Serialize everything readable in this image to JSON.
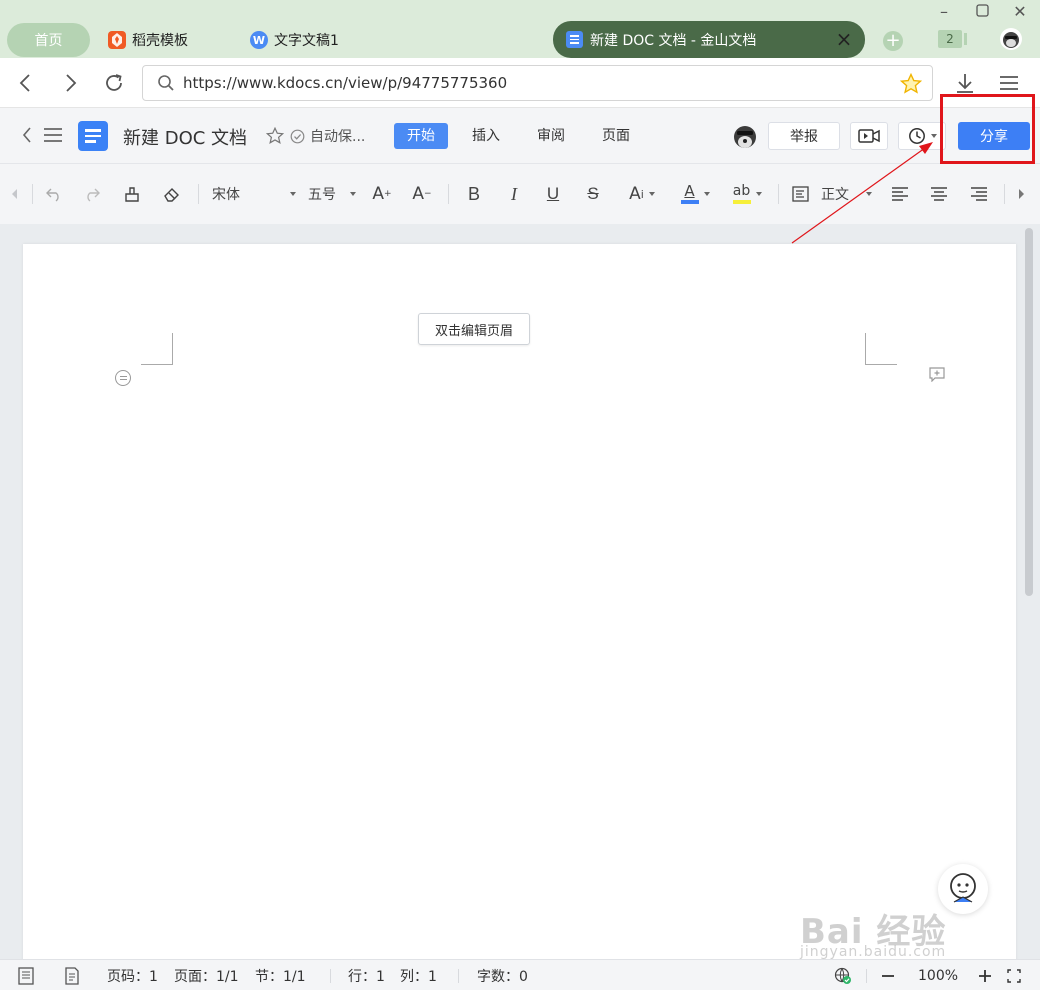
{
  "browser": {
    "tabs": {
      "home": "首页",
      "tab1": "稻壳模板",
      "tab2": "文字文稿1",
      "active": "新建 DOC 文档 - 金山文档"
    },
    "tab_count": "2",
    "url": "https://www.kdocs.cn/view/p/94775775360"
  },
  "app": {
    "doc_title": "新建 DOC 文档",
    "autosave": "自动保...",
    "menu": [
      "开始",
      "插入",
      "审阅",
      "页面"
    ],
    "report_label": "举报",
    "share_label": "分享"
  },
  "toolbar": {
    "font_name": "宋体",
    "font_size": "五号",
    "style_label": "正文",
    "font_color": "#3d7ff5",
    "highlight_color": "#f6ef3a"
  },
  "document": {
    "header_hint": "双击编辑页眉"
  },
  "watermark": {
    "main": "Bai 经验",
    "sub": "jingyan.baidu.com"
  },
  "statusbar": {
    "page_num": "页码：1",
    "pages": "页面：1/1",
    "section": "节：1/1",
    "row": "行：1",
    "col": "列：1",
    "words": "字数：0",
    "zoom": "100%"
  },
  "colors": {
    "accent": "#3d7ff5",
    "active_tab": "#4a6a48",
    "annotation": "#e0161b"
  }
}
